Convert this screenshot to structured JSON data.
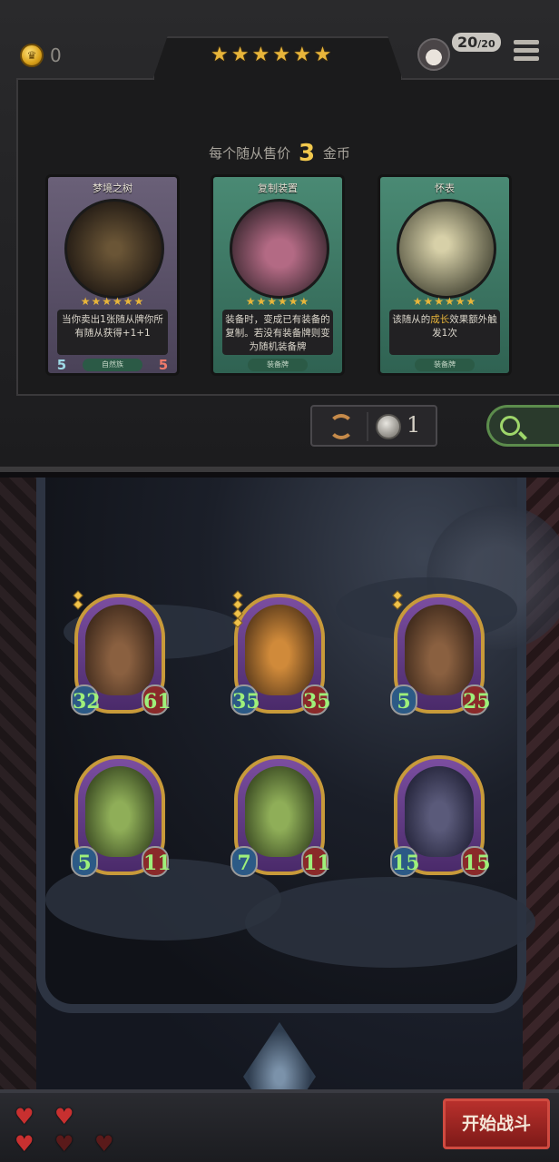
{
  "header": {
    "gold": "0",
    "tavern_stars": 6,
    "population": "20",
    "population_max": "20"
  },
  "shop": {
    "sell_prefix": "每个随从售价",
    "sell_price": "3",
    "sell_suffix": "金币",
    "cards": [
      {
        "title": "梦境之树",
        "stars": 6,
        "description": "当你卖出1张随从牌你所有随从获得+1+1",
        "tag": "自然族",
        "attack": "5",
        "health": "5"
      },
      {
        "title": "复制装置",
        "stars": 6,
        "description": "装备时，变成已有装备的复制。若没有装备牌则变为随机装备牌",
        "tag": "装备牌"
      },
      {
        "title": "怀表",
        "stars": 6,
        "description_pre": "该随从的",
        "description_hl": "成长",
        "description_post": "效果额外触发1次",
        "tag": "装备牌"
      }
    ],
    "refresh_cost": "1"
  },
  "board": {
    "minions": [
      {
        "kind": "tree",
        "attack": "32",
        "health": "61",
        "pips": 2
      },
      {
        "kind": "pumpkin",
        "attack": "35",
        "health": "35",
        "pips": 4
      },
      {
        "kind": "tree",
        "attack": "5",
        "health": "25",
        "pips": 2
      },
      {
        "kind": "goblin",
        "attack": "5",
        "health": "11",
        "pips": 0
      },
      {
        "kind": "goblin",
        "attack": "7",
        "health": "11",
        "pips": 0
      },
      {
        "kind": "reaper",
        "attack": "15",
        "health": "15",
        "pips": 0
      }
    ]
  },
  "footer": {
    "lives_full": 3,
    "lives_total": 5,
    "start_label": "开始战斗"
  },
  "icons": {
    "coin": "coin-icon",
    "menu": "hamburger-menu-icon",
    "refresh": "refresh-icon",
    "search": "magnifier-icon",
    "heart": "heart-icon"
  },
  "colors": {
    "gold_star": "#e8b53a",
    "start_button": "#b8302c",
    "stat_green": "#9ef07a"
  }
}
